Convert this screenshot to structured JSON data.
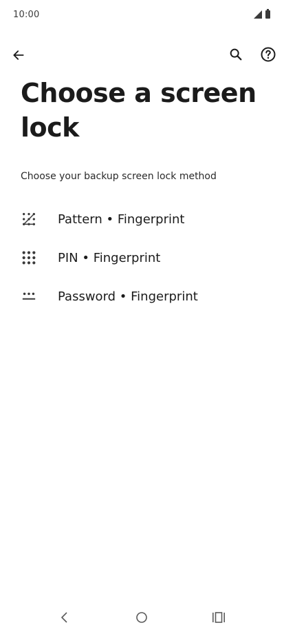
{
  "status_bar": {
    "time": "10:00",
    "icons": [
      "cellular-signal-icon",
      "battery-icon"
    ]
  },
  "toolbar": {
    "icons": [
      "back-arrow-icon",
      "search-icon",
      "help-icon"
    ]
  },
  "page": {
    "title": "Choose a screen lock",
    "subtitle": "Choose your backup screen lock method"
  },
  "options": [
    {
      "label": "Pattern • Fingerprint",
      "icon": "pattern-icon"
    },
    {
      "label": "PIN • Fingerprint",
      "icon": "pin-keypad-icon"
    },
    {
      "label": "Password • Fingerprint",
      "icon": "password-icon"
    }
  ],
  "nav_bar": {
    "icons": [
      "nav-back-icon",
      "nav-home-icon",
      "nav-recents-icon"
    ]
  },
  "colors": {
    "text": "#1b1b1b",
    "icon": "#3a3a3a",
    "background": "#ffffff"
  }
}
